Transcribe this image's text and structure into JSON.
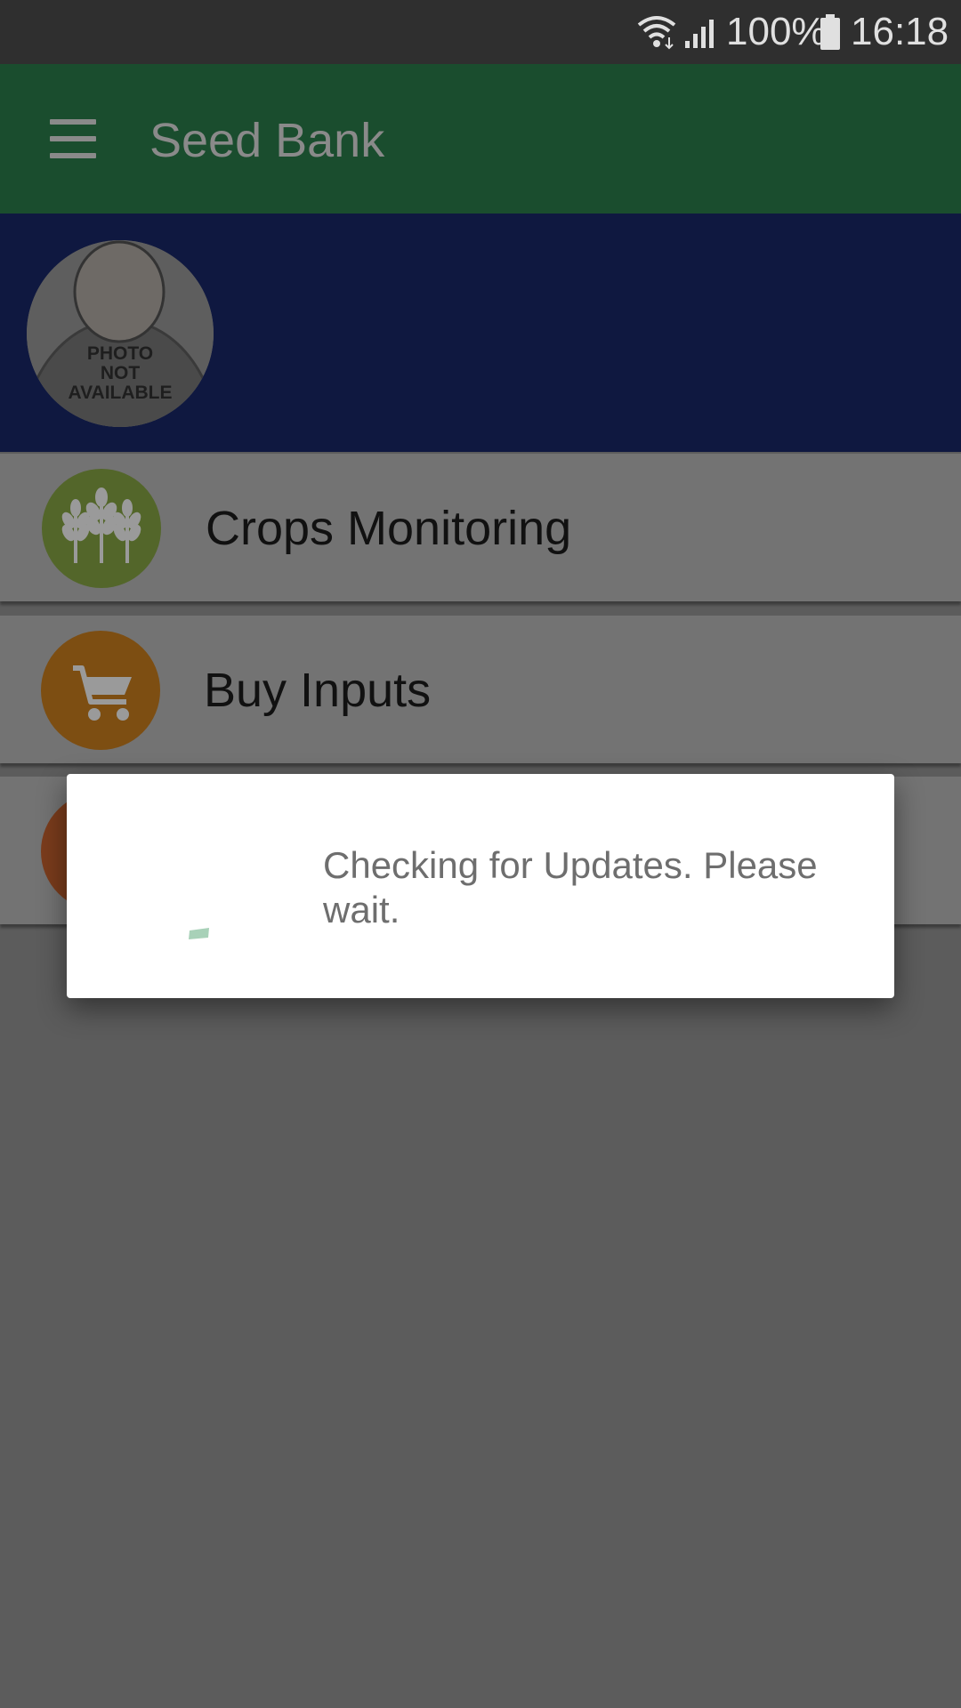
{
  "status_bar": {
    "battery": "100%",
    "time": "16:18",
    "icons": [
      "wifi-icon",
      "signal-icon",
      "battery-icon"
    ]
  },
  "app_bar": {
    "title": "Seed Bank",
    "menu_icon": "hamburger-menu-icon"
  },
  "profile": {
    "photo_placeholder": "PHOTO NOT AVAILABLE"
  },
  "menu": {
    "items": [
      {
        "label": "Crops Monitoring",
        "icon": "wheat-icon",
        "color": "#53662a"
      },
      {
        "label": "Buy Inputs",
        "icon": "cart-icon",
        "color": "#7d4e12"
      },
      {
        "label": "",
        "icon": "unknown-icon",
        "color": "#7a3c1c"
      }
    ]
  },
  "dialog": {
    "message": "Checking for Updates. Please wait.",
    "spinner_color": "#a8d1b8"
  },
  "colors": {
    "app_bar": "#1a4d2e",
    "profile_header": "#0f1840",
    "scrim_background": "#5c5c5c"
  }
}
